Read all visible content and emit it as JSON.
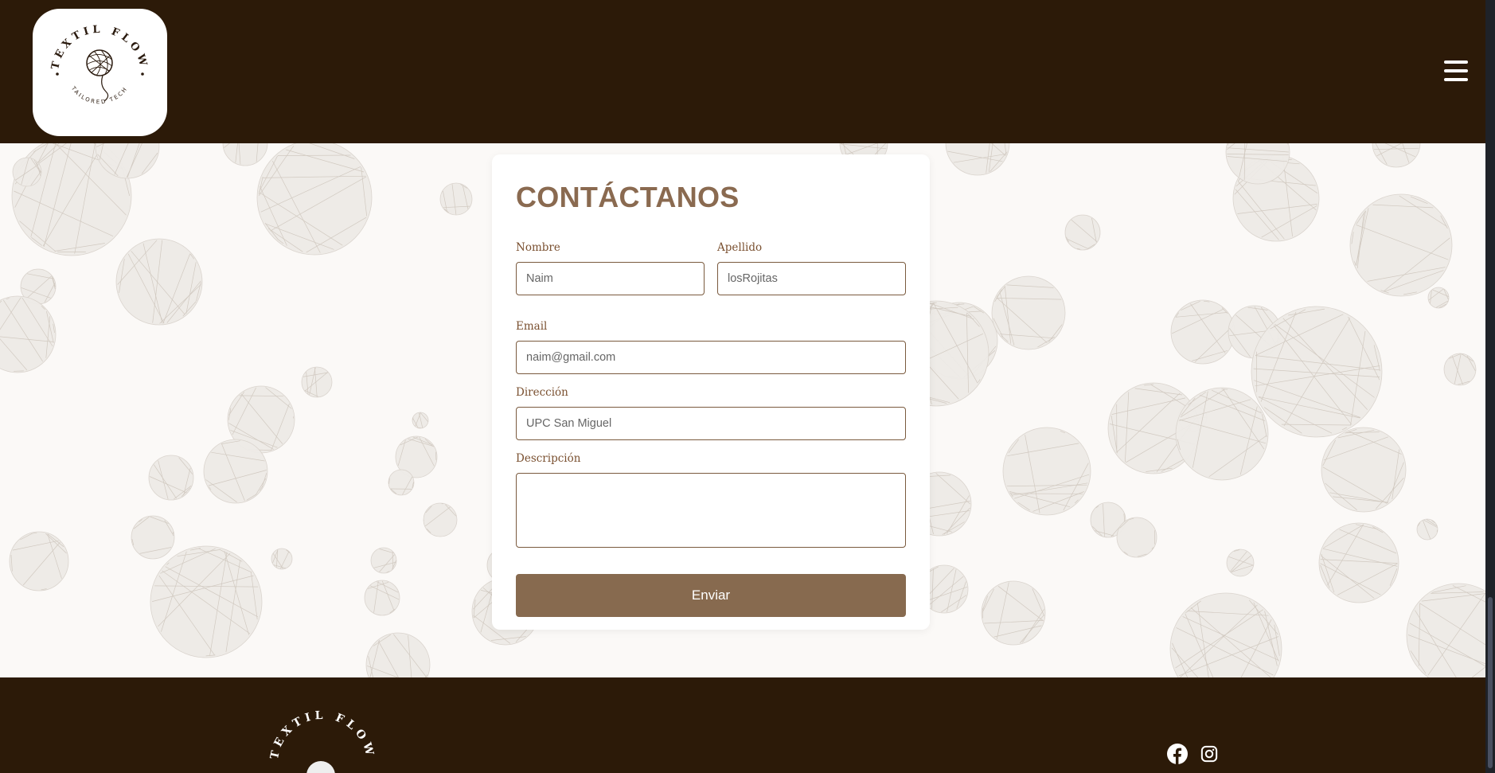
{
  "header": {
    "logo": {
      "brand": "TEXTIL FLOW",
      "tagline": "TAILORED TECH"
    },
    "menu_icon": "hamburger-menu-icon"
  },
  "contact_form": {
    "title": "CONTÁCTANOS",
    "fields": {
      "nombre": {
        "label": "Nombre",
        "value": "Naim"
      },
      "apellido": {
        "label": "Apellido",
        "value": "losRojitas"
      },
      "email": {
        "label": "Email",
        "value": "naim@gmail.com"
      },
      "direccion": {
        "label": "Dirección",
        "value": "UPC San Miguel"
      },
      "descripcion": {
        "label": "Descripción",
        "value": ""
      }
    },
    "submit_label": "Enviar"
  },
  "footer": {
    "logo": {
      "brand": "TEXTIL FLOW"
    },
    "social": [
      "facebook-icon",
      "instagram-icon"
    ]
  },
  "colors": {
    "header_bg": "#2c1a08",
    "accent": "#876a4f",
    "title": "#8a6a50",
    "page_bg": "#fbf9f7"
  }
}
